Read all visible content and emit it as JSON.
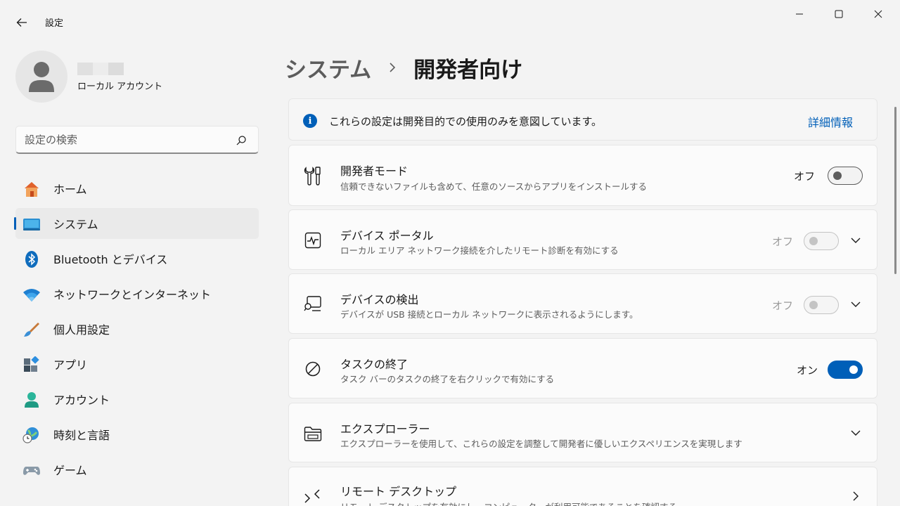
{
  "window": {
    "title": "設定",
    "controls": [
      "minimize-icon",
      "maximize-icon",
      "close-icon"
    ]
  },
  "profile": {
    "account_type": "ローカル アカウント"
  },
  "search": {
    "placeholder": "設定の検索"
  },
  "sidebar": {
    "items": [
      {
        "label": "ホーム",
        "icon": "home-icon"
      },
      {
        "label": "システム",
        "icon": "system-icon",
        "active": true
      },
      {
        "label": "Bluetooth とデバイス",
        "icon": "bluetooth-icon"
      },
      {
        "label": "ネットワークとインターネット",
        "icon": "wifi-icon"
      },
      {
        "label": "個人用設定",
        "icon": "brush-icon"
      },
      {
        "label": "アプリ",
        "icon": "apps-icon"
      },
      {
        "label": "アカウント",
        "icon": "account-icon"
      },
      {
        "label": "時刻と言語",
        "icon": "globe-clock-icon"
      },
      {
        "label": "ゲーム",
        "icon": "gamepad-icon"
      }
    ]
  },
  "breadcrumb": {
    "parent": "システム",
    "current": "開発者向け"
  },
  "info": {
    "text": "これらの設定は開発目的での使用のみを意図しています。",
    "link": "詳細情報"
  },
  "settings": [
    {
      "title": "開発者モード",
      "desc": "信頼できないファイルも含めて、任意のソースからアプリをインストールする",
      "state": "オフ",
      "icon": "developer-tools-icon"
    },
    {
      "title": "デバイス ポータル",
      "desc": "ローカル エリア ネットワーク接続を介したリモート診断を有効にする",
      "state": "オフ",
      "icon": "pulse-monitor-icon"
    },
    {
      "title": "デバイスの検出",
      "desc": "デバイスが USB 接続とローカル ネットワークに表示されるようにします。",
      "state": "オフ",
      "icon": "device-search-icon"
    },
    {
      "title": "タスクの終了",
      "desc": "タスク バーのタスクの終了を右クリックで有効にする",
      "state": "オン",
      "icon": "prohibited-icon"
    },
    {
      "title": "エクスプローラー",
      "desc": "エクスプローラーを使用して、これらの設定を調整して開発者に優しいエクスペリエンスを実現します",
      "icon": "folder-icon"
    },
    {
      "title": "リモート デスクトップ",
      "desc": "リモート デスクトップを有効にし、コンピューターが利用可能であることを確認する",
      "icon": "remote-desktop-icon"
    }
  ],
  "colors": {
    "accent": "#005fb8",
    "background": "#f3f3f3",
    "card": "#fbfbfb"
  }
}
